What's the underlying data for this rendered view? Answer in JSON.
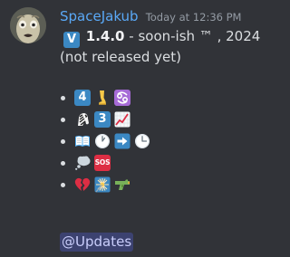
{
  "message": {
    "author": "SpaceJakub",
    "timestamp": "Today at 12:36 PM",
    "version_badge": "V",
    "version": "1.4.0",
    "separator": " -  ",
    "release_text": "soon-ish ™ , 2024 (not released yet)",
    "mention": "@Updates",
    "emoji_rows": [
      [
        "keycap-4",
        "leg",
        "cancer-zodiac"
      ],
      [
        "zebra",
        "keycap-3",
        "chart-increasing"
      ],
      [
        "open-book",
        "clock-one",
        "right-arrow",
        "clock-three"
      ],
      [
        "thought-bubble",
        "sos-button"
      ],
      [
        "broken-heart",
        "sparkler",
        "water-pistol"
      ]
    ],
    "keycap_labels": {
      "keycap_4": "4",
      "keycap_3": "3",
      "sos": "SOS"
    }
  },
  "colors": {
    "background": "#313338",
    "username": "#5aa9f7",
    "text": "#dbdee1",
    "timestamp": "#949ba4",
    "mention_bg": "#3c4270",
    "mention_text": "#c9cdfb",
    "keycap_blue": "#3b88c3"
  }
}
